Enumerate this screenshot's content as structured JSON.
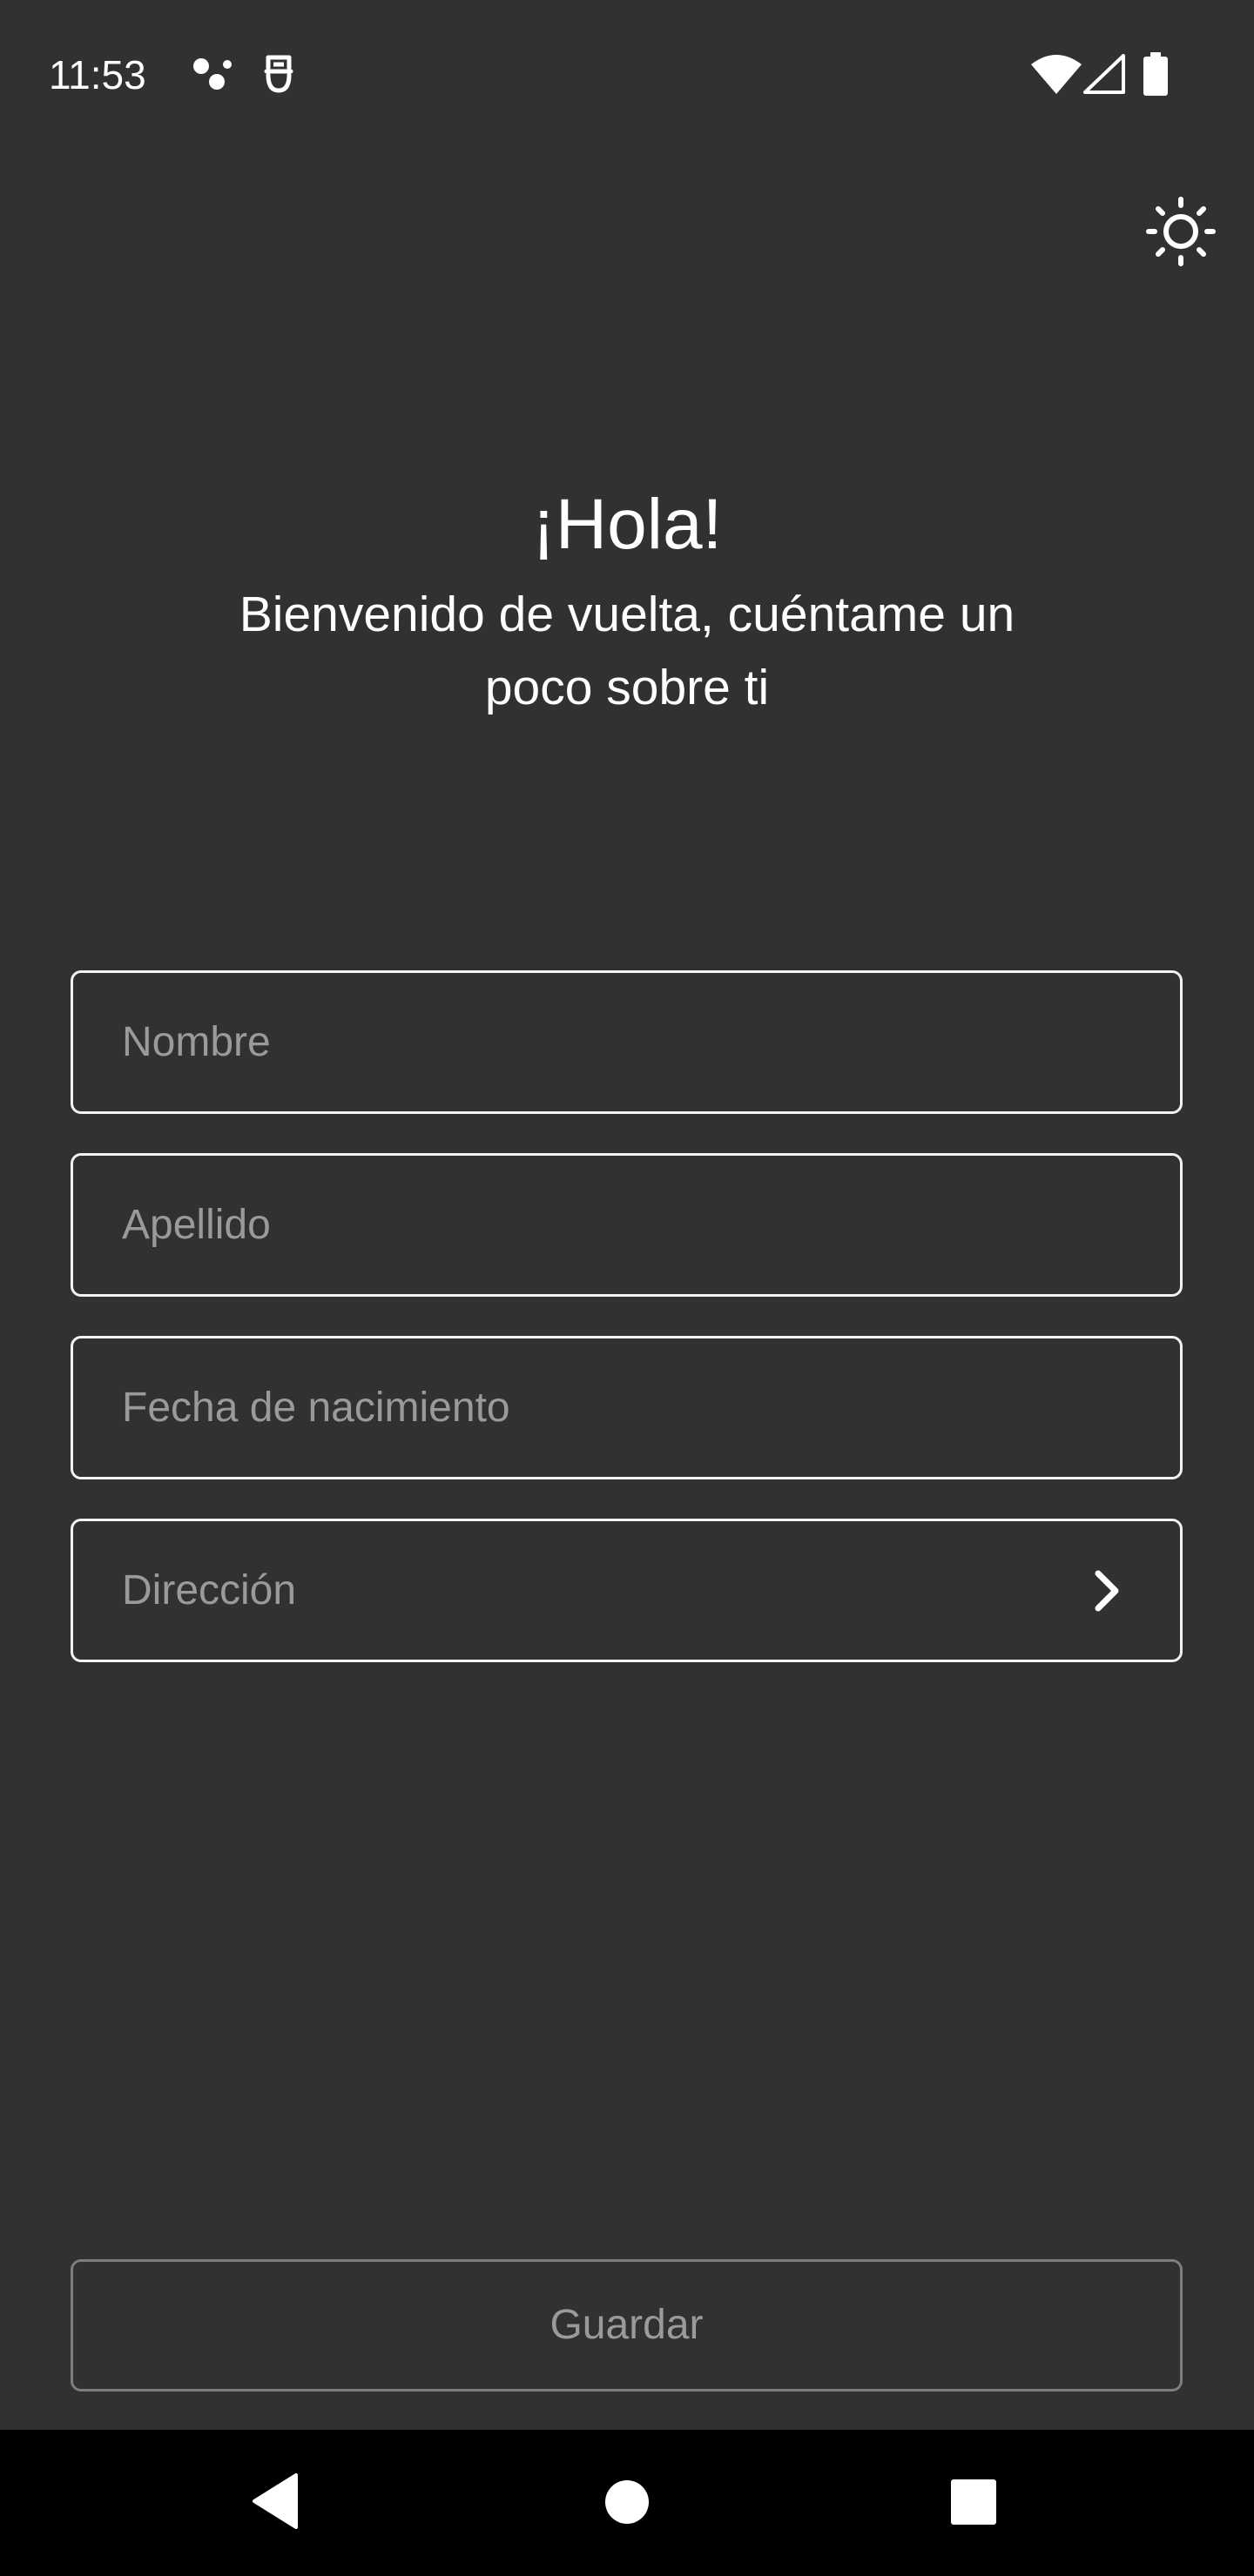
{
  "status_bar": {
    "time": "11:53",
    "icons": [
      "assistant-dots-icon",
      "sim-toolkit-icon",
      "wifi-icon",
      "cellular-signal-icon",
      "battery-icon"
    ]
  },
  "header": {
    "theme_toggle_icon": "sun-icon"
  },
  "hero": {
    "greeting": "¡Hola!",
    "subtitle": "Bienvenido de vuelta, cuéntame un poco sobre ti"
  },
  "form": {
    "first_name": {
      "placeholder": "Nombre",
      "value": ""
    },
    "last_name": {
      "placeholder": "Apellido",
      "value": ""
    },
    "birth_date": {
      "placeholder": "Fecha de nacimiento",
      "value": ""
    },
    "address": {
      "label": "Dirección",
      "icon": "chevron-right-icon"
    }
  },
  "actions": {
    "save_label": "Guardar"
  },
  "nav_bar": {
    "buttons": [
      "back-icon",
      "home-icon",
      "recents-icon"
    ]
  },
  "colors": {
    "background": "#313131",
    "field_border": "#f2f2f2",
    "placeholder": "#9a9a9a",
    "disabled_border": "#7d7d7d",
    "nav_background": "#000000"
  }
}
